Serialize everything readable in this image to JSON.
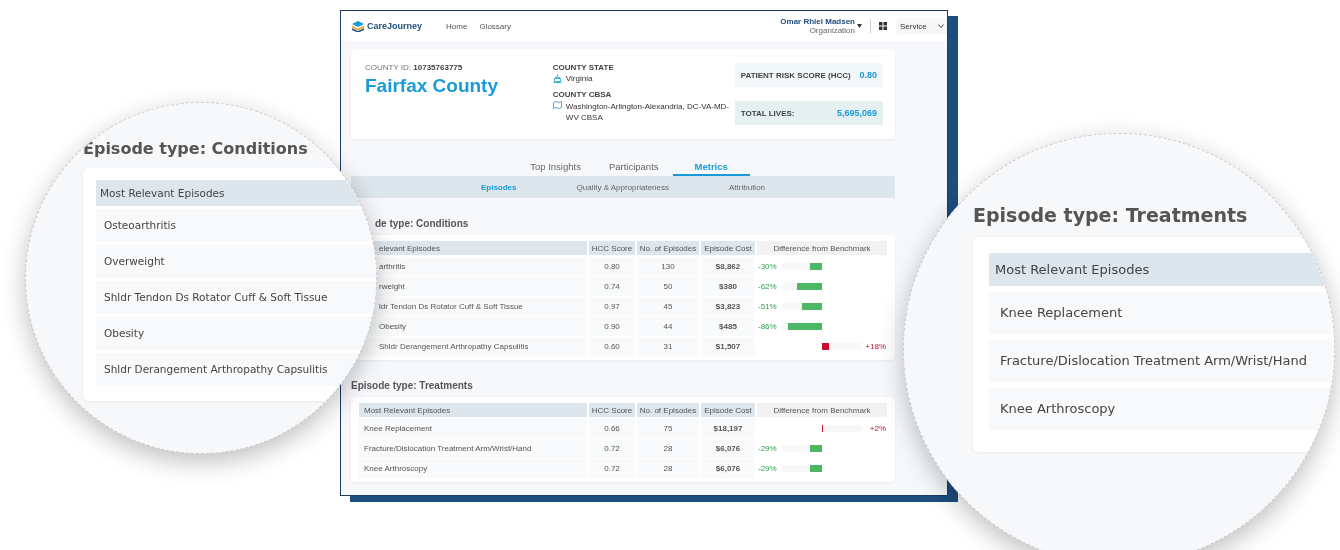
{
  "app": {
    "logo": "CareJourney",
    "nav": [
      "Home",
      "Glossary"
    ],
    "user": {
      "name": "Omar Rhiel Madsen",
      "role": "Organization"
    },
    "service_select": {
      "value": "Service"
    }
  },
  "county": {
    "id_label": "COUNTY ID:",
    "id": "10735763775",
    "name": "Fairfax County",
    "state_label": "COUNTY STATE",
    "state": "Virginia",
    "cbsa_label": "COUNTY CBSA",
    "cbsa": "Washington-Arlington-Alexandria, DC-VA-MD-WV CBSA",
    "stats": [
      {
        "label": "PATIENT RISK SCORE (HCC)",
        "value": "0.80"
      },
      {
        "label": "TOTAL LIVES:",
        "value": "5,695,069"
      }
    ]
  },
  "tabs": [
    {
      "label": "Top Insights",
      "selected": false
    },
    {
      "label": "Participants",
      "selected": false
    },
    {
      "label": "Metrics",
      "selected": true
    }
  ],
  "subtabs": [
    {
      "label": "Episodes",
      "selected": true
    },
    {
      "label": "Quality & Appropriateness",
      "selected": false
    },
    {
      "label": "Attribution",
      "selected": false
    }
  ],
  "sections": [
    {
      "title": "de type: Conditions",
      "occluded": true,
      "columns": [
        "elevant Episodes",
        "HCC Score",
        "No. of Episodes",
        "Episode Cost",
        "Difference from Benchmark"
      ],
      "rows": [
        {
          "name": "arthritis",
          "hcc": "0.80",
          "episodes": "130",
          "cost": "$8,862",
          "diff": {
            "text": "-30%",
            "kind": "below",
            "level": 0.3
          }
        },
        {
          "name": "rweight",
          "hcc": "0.74",
          "episodes": "50",
          "cost": "$380",
          "diff": {
            "text": "-62%",
            "kind": "below",
            "level": 0.62
          }
        },
        {
          "name": "ldr Tendon Ds Rotator Cuff & Soft Tissue",
          "hcc": "0.97",
          "episodes": "45",
          "cost": "$3,823",
          "diff": {
            "text": "-51%",
            "kind": "below",
            "level": 0.51
          }
        },
        {
          "name": "Obesity",
          "hcc": "0.90",
          "episodes": "44",
          "cost": "$485",
          "diff": {
            "text": "-86%",
            "kind": "below",
            "level": 0.86
          }
        },
        {
          "name": "Shldr Derangement Arthropathy Capsulitis",
          "hcc": "0.60",
          "episodes": "31",
          "cost": "$1,507",
          "diff": {
            "text": "+18%",
            "kind": "above",
            "level": 0.18
          }
        }
      ]
    },
    {
      "title": "Episode type: Treatments",
      "occluded": false,
      "columns": [
        "Most Relevant Episodes",
        "HCC Score",
        "No. of Episodes",
        "Episode Cost",
        "Difference from Benchmark"
      ],
      "rows": [
        {
          "name": "Knee Replacement",
          "hcc": "0.66",
          "episodes": "75",
          "cost": "$18,197",
          "diff": {
            "text": "+2%",
            "kind": "above",
            "level": 0.03
          }
        },
        {
          "name": "Fracture/Dislocation Treatment Arm/Wrist/Hand",
          "hcc": "0.72",
          "episodes": "28",
          "cost": "$6,076",
          "diff": {
            "text": "-29%",
            "kind": "below",
            "level": 0.29
          }
        },
        {
          "name": "Knee Arthroscopy",
          "hcc": "0.72",
          "episodes": "28",
          "cost": "$6,076",
          "diff": {
            "text": "-29%",
            "kind": "below",
            "level": 0.29
          }
        }
      ]
    }
  ],
  "magnifiers": [
    {
      "title": "Episode type: Conditions",
      "header": "Most Relevant Episodes",
      "rows": [
        "Osteoarthritis",
        "Overweight",
        "Shldr Tendon Ds Rotator Cuff & Soft Tissue",
        "Obesity",
        "Shldr Derangement Arthropathy Capsulitis"
      ]
    },
    {
      "title": "Episode type: Treatments",
      "header": "Most Relevant Episodes",
      "rows": [
        "Knee Replacement",
        "Fracture/Dislocation Treatment Arm/Wrist/Hand",
        "Knee Arthroscopy"
      ]
    }
  ]
}
